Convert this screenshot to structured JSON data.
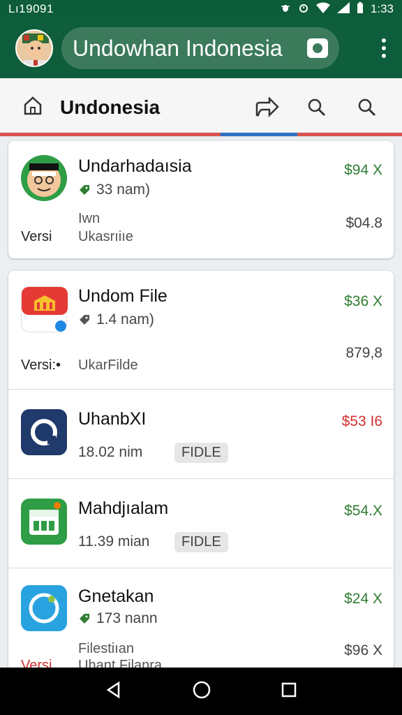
{
  "status": {
    "time_left": "Lı19091",
    "time_right": "1:33"
  },
  "appbar": {
    "search_text": "Undowhan Indonesia"
  },
  "toolbar": {
    "title": "Undonesia"
  },
  "items": [
    {
      "name": "Undarhadaısia",
      "sub": "33 nam)",
      "line3a": "Iwn",
      "line3b": "Ukasrıiıe",
      "versi": "Versi",
      "price": "$94 X",
      "price2": "$04.8",
      "color": "#2e7d32"
    },
    {
      "name": "Undom File",
      "sub": "1.4 nam)",
      "line3b": "UkarFilde",
      "versi": "Versi:•",
      "price": "$36 X",
      "price2": "879,8",
      "color": "#2e7d32"
    },
    {
      "name": "UhanbXI",
      "sub": "18.02 nim",
      "badge": "FIDLE",
      "price": "$53 I6",
      "color": "#d32f2f"
    },
    {
      "name": "Mahdjıalam",
      "sub": "11.39 mian",
      "badge": "FIDLE",
      "price": "$54.X",
      "color": "#2e7d32"
    },
    {
      "name": "Gnetakan",
      "sub": "173 nann",
      "line3a": "Filestiıan",
      "line3b": "Uhant Filanra",
      "versi": "Versi",
      "price": "$24 X",
      "price2": "$96 X",
      "color": "#2e7d32"
    }
  ]
}
